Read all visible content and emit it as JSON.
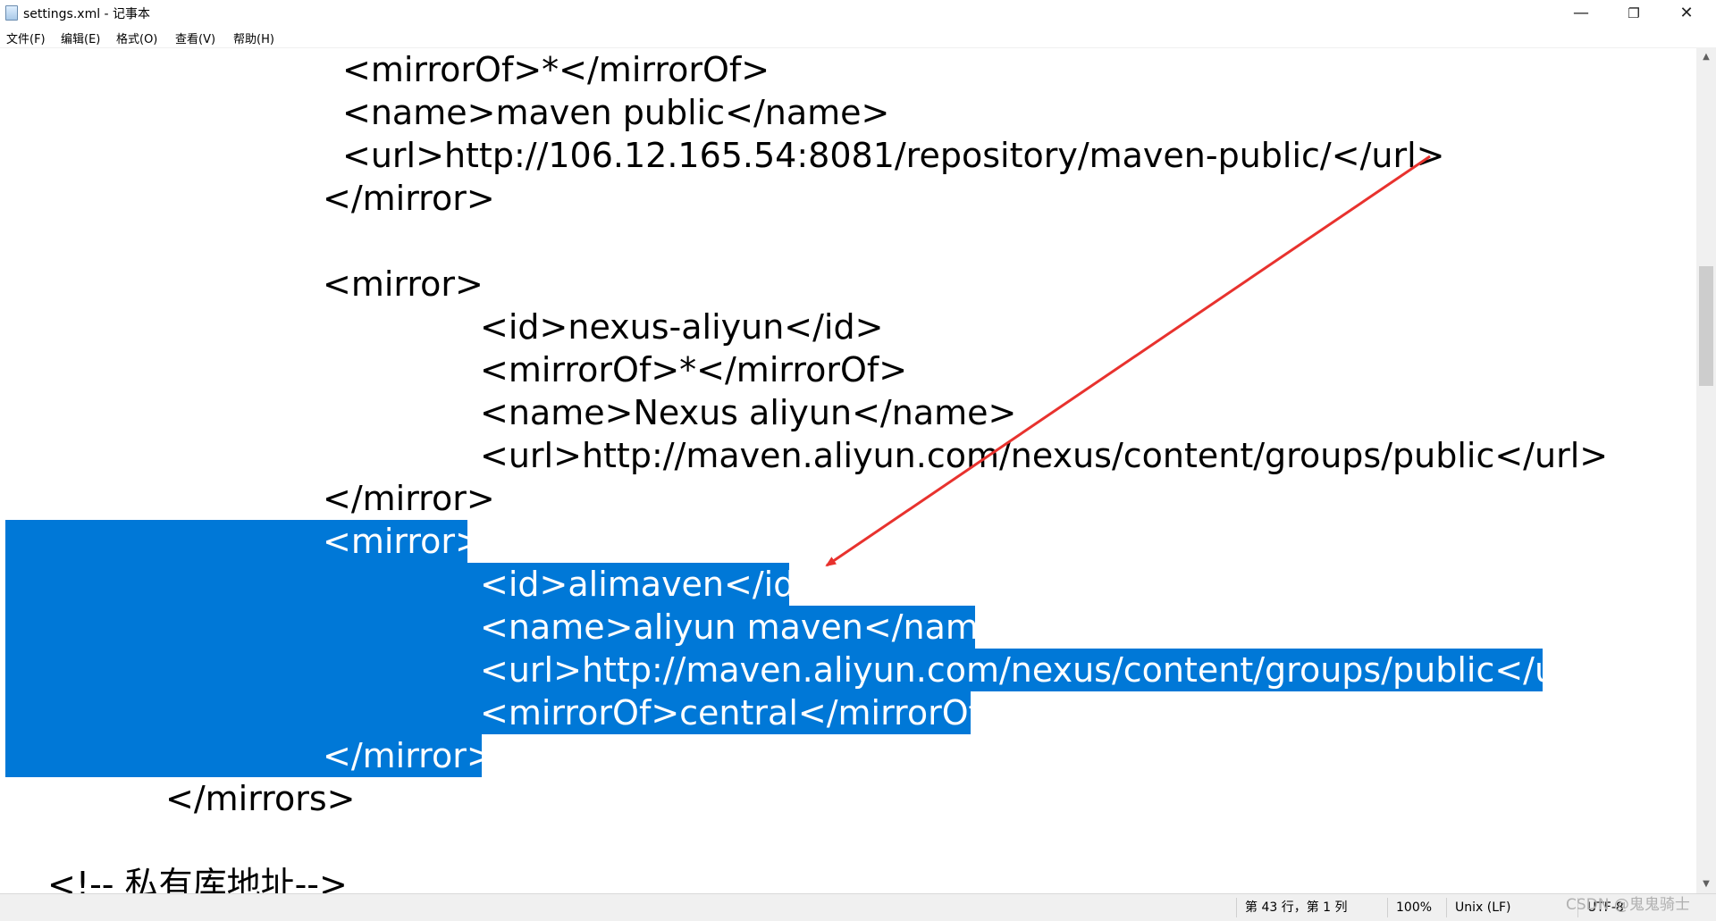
{
  "window": {
    "title": "settings.xml - 记事本",
    "icon": "notepad-icon",
    "controls": {
      "minimize": "—",
      "maximize": "❐",
      "close": "✕"
    }
  },
  "menu": [
    {
      "label": "文件(F)"
    },
    {
      "label": "编辑(E)"
    },
    {
      "label": "格式(O)"
    },
    {
      "label": "查看(V)"
    },
    {
      "label": "帮助(H)"
    }
  ],
  "editor": {
    "lines": [
      {
        "text": "<mirrorOf>*</mirrorOf>",
        "selected": false
      },
      {
        "text": "<name>maven public</name>",
        "selected": false
      },
      {
        "text": "<url>http://106.12.165.54:8081/repository/maven-public/</url>",
        "selected": false
      },
      {
        "text": "</mirror>",
        "selected": false
      },
      {
        "text": "",
        "selected": false
      },
      {
        "text": "<mirror>",
        "selected": false
      },
      {
        "text": "<id>nexus-aliyun</id>",
        "selected": false
      },
      {
        "text": "<mirrorOf>*</mirrorOf>",
        "selected": false
      },
      {
        "text": "<name>Nexus aliyun</name>",
        "selected": false
      },
      {
        "text": "<url>http://maven.aliyun.com/nexus/content/groups/public</url>",
        "selected": false
      },
      {
        "text": "</mirror>",
        "selected": false
      },
      {
        "text": "<mirror>",
        "selected": true
      },
      {
        "text": "<id>alimaven</id>",
        "selected": true
      },
      {
        "text": "<name>aliyun maven</name>",
        "selected": true
      },
      {
        "text": "<url>http://maven.aliyun.com/nexus/content/groups/public</url>",
        "selected": true
      },
      {
        "text": "<mirrorOf>central</mirrorOf>",
        "selected": true
      },
      {
        "text": "</mirror>",
        "selected": true
      },
      {
        "text": "</mirrors>",
        "selected": false
      },
      {
        "text": "",
        "selected": false
      },
      {
        "text": "<!-- 私有库地址-->",
        "selected": false
      }
    ],
    "selection_color": "#0078d7",
    "annotation_arrow_color": "#e8322e"
  },
  "statusbar": {
    "position": "第 43 行，第 1 列",
    "zoom": "100%",
    "line_ending": "Unix (LF)",
    "encoding": "UTF-8"
  },
  "watermark": "CSDN @鬼鬼骑士"
}
